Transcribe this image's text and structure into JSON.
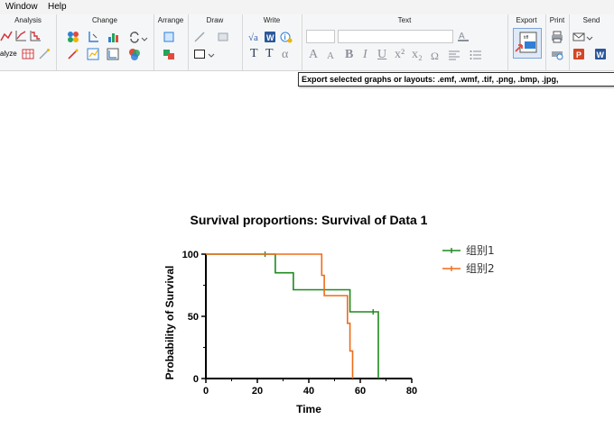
{
  "menu": {
    "window": "Window",
    "help": "Help"
  },
  "ribbon": {
    "groups": {
      "analysis": "Analysis",
      "change": "Change",
      "arrange": "Arrange",
      "draw": "Draw",
      "write": "Write",
      "text": "Text",
      "export": "Export",
      "print": "Print",
      "send": "Send"
    },
    "analyze_label": "alyze",
    "alpha_symbol": "α",
    "text_buttons": {
      "t_bold": "T",
      "t_small": "T",
      "bold": "B",
      "italic": "I",
      "underline": "U"
    }
  },
  "tooltip": {
    "text": "Export selected graphs or layouts:  .emf, .wmf,  .tif, .png, .bmp, .jpg,"
  },
  "colors": {
    "series1": "#1e8a1e",
    "series2": "#ef6c1a",
    "axis": "#000000"
  },
  "chart_data": {
    "type": "line",
    "title": "Survival proportions: Survival of Data 1",
    "xlabel": "Time",
    "ylabel": "Probability of Survival",
    "xlim": [
      0,
      80
    ],
    "ylim": [
      0,
      100
    ],
    "xticks": [
      "0",
      "20",
      "40",
      "60",
      "80"
    ],
    "yticks": [
      "0",
      "50",
      "100"
    ],
    "legend_position": "right",
    "series": [
      {
        "name": "组别1",
        "color": "#1e8a1e",
        "steps": [
          [
            0,
            100
          ],
          [
            27,
            100
          ],
          [
            27,
            85
          ],
          [
            34,
            85
          ],
          [
            34,
            71.4
          ],
          [
            56,
            71.4
          ],
          [
            56,
            53.6
          ],
          [
            67,
            53.6
          ],
          [
            67,
            0
          ]
        ],
        "censored": [
          [
            23,
            100
          ],
          [
            65,
            53.6
          ]
        ]
      },
      {
        "name": "组别2",
        "color": "#ef6c1a",
        "steps": [
          [
            0,
            100
          ],
          [
            45,
            100
          ],
          [
            45,
            83
          ],
          [
            46,
            83
          ],
          [
            46,
            66.7
          ],
          [
            55,
            66.7
          ],
          [
            55,
            44.4
          ],
          [
            56,
            44.4
          ],
          [
            56,
            22.2
          ],
          [
            57,
            22.2
          ],
          [
            57,
            0
          ]
        ],
        "censored": []
      }
    ]
  }
}
